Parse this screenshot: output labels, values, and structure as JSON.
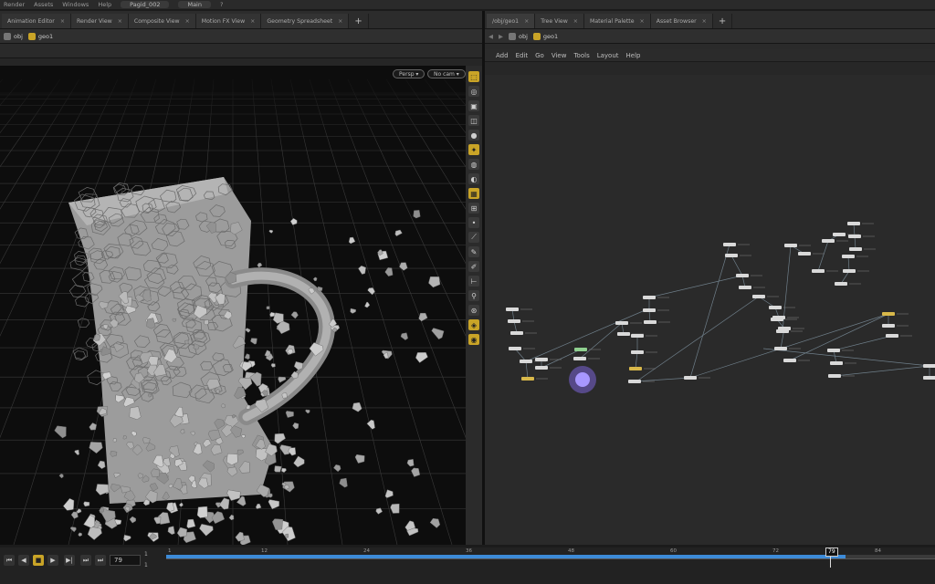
{
  "menubar": {
    "items": [
      "Render",
      "Assets",
      "Windows",
      "Help"
    ],
    "file_name": "Pagid_002",
    "desktop": "Main",
    "help_glyph": "?"
  },
  "left_pane": {
    "tabs": [
      "Animation Editor",
      "Render View",
      "Composite View",
      "Motion FX View",
      "Geometry Spreadsheet"
    ],
    "path": {
      "obj": "obj",
      "node": "geo1"
    },
    "viewport": {
      "camera_menu": "Persp",
      "cam_menu": "No cam"
    }
  },
  "right_pane": {
    "tabs": [
      "/obj/geo1",
      "Tree View",
      "Material Palette",
      "Asset Browser"
    ],
    "path": {
      "obj": "obj",
      "node": "geo1"
    },
    "menu": [
      "Add",
      "Edit",
      "Go",
      "View",
      "Tools",
      "Layout",
      "Help"
    ]
  },
  "timeline": {
    "current_frame": "79",
    "start_value": "1",
    "end_value": "1",
    "tick_labels": [
      "1",
      "12",
      "24",
      "36",
      "48",
      "60",
      "72",
      "79",
      "84"
    ],
    "playhead_label": "79"
  }
}
